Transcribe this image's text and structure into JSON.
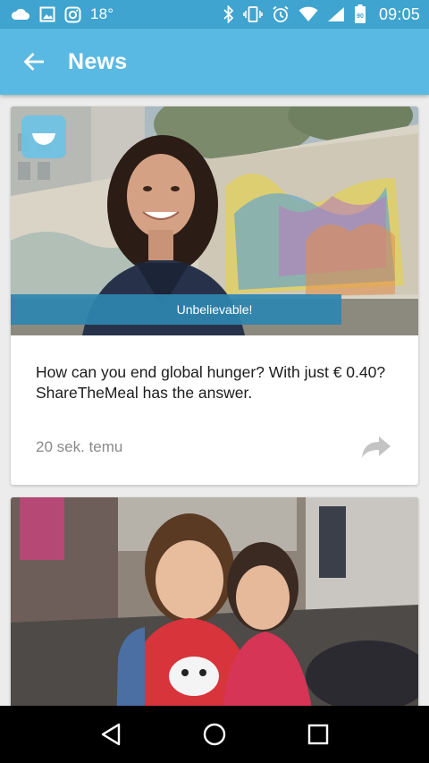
{
  "status_bar": {
    "temperature": "18°",
    "time": "09:05",
    "battery_level": "90",
    "icons": [
      "cloud-icon",
      "image-icon",
      "instagram-icon",
      "bluetooth-icon",
      "vibrate-icon",
      "alarm-icon",
      "wifi-icon",
      "signal-icon",
      "battery-icon"
    ]
  },
  "app_bar": {
    "title": "News",
    "back_icon": "arrow-left-icon"
  },
  "feed": {
    "cards": [
      {
        "image_caption": "Unbelievable!",
        "image_description": "woman-smiling-in-front-of-graffiti-wall",
        "headline": "How can you end global hunger? With just € 0.40? ShareTheMeal has the answer.",
        "time": "20 sek. temu",
        "share_icon": "share-icon"
      },
      {
        "image_description": "two-children-smiling-in-camp"
      }
    ]
  },
  "nav_bar": {
    "icons": [
      "back-triangle-icon",
      "home-circle-icon",
      "recents-square-icon"
    ]
  },
  "colors": {
    "status_bar": "#3fa4cf",
    "app_bar": "#5ab9e2",
    "caption_band": "#2e86b0",
    "background": "#ececec"
  }
}
